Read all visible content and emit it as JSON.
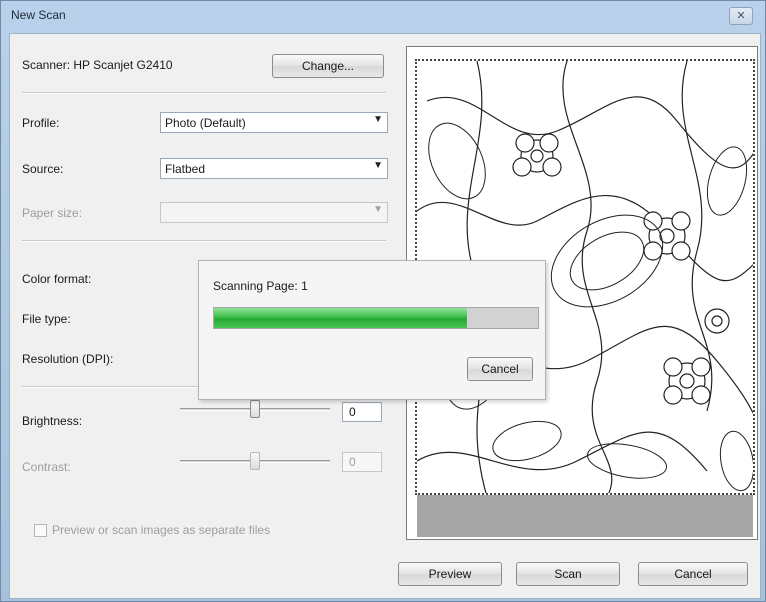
{
  "window": {
    "title": "New Scan",
    "close_icon": "close-icon"
  },
  "scanner": {
    "label": "Scanner: HP Scanjet G2410",
    "change_button": "Change..."
  },
  "settings": {
    "profile": {
      "label": "Profile:",
      "value": "Photo (Default)"
    },
    "source": {
      "label": "Source:",
      "value": "Flatbed"
    },
    "paper_size": {
      "label": "Paper size:",
      "value": ""
    },
    "color_format": {
      "label": "Color format:"
    },
    "file_type": {
      "label": "File type:"
    },
    "resolution": {
      "label": "Resolution (DPI):"
    },
    "brightness": {
      "label": "Brightness:",
      "value": "0",
      "level": 0.5
    },
    "contrast": {
      "label": "Contrast:",
      "value": "0",
      "level": 0.5
    }
  },
  "preview_option": {
    "label": "Preview or scan images as separate files",
    "checked": false
  },
  "progress": {
    "status": "Scanning Page: 1",
    "percent": 78,
    "cancel_label": "Cancel"
  },
  "footer": {
    "preview_button": "Preview",
    "scan_button": "Scan",
    "cancel_button": "Cancel"
  },
  "colors": {
    "progress_green": "#2fb33b",
    "preview_empty": "#a5a5a5"
  }
}
